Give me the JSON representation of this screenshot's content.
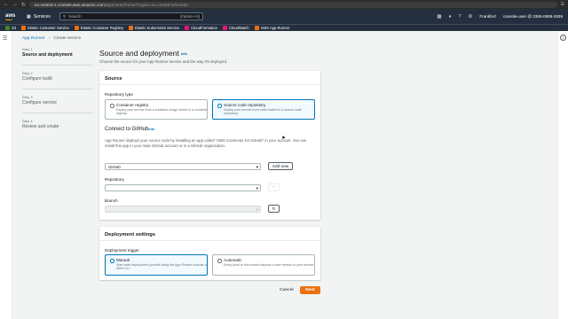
{
  "browser": {
    "url_host": "eu-central-1.console.aws.amazon.com",
    "url_path": "/apprunner/home?region=eu-central-1#/create"
  },
  "topnav": {
    "logo": "aws",
    "services_label": "Services",
    "search_placeholder": "Search",
    "search_shortcut": "[Option+S]",
    "region": "Frankfurt",
    "account": "console-user @ 3385-0698-2839"
  },
  "favorites": [
    {
      "label": "S3",
      "color": "#3f8624"
    },
    {
      "label": "Elastic Container Service",
      "color": "#ec7211"
    },
    {
      "label": "Elastic Container Registry",
      "color": "#ec7211"
    },
    {
      "label": "Elastic Kubernetes Service",
      "color": "#ec7211"
    },
    {
      "label": "CloudFormation",
      "color": "#e7157b"
    },
    {
      "label": "CloudWatch",
      "color": "#e7157b"
    },
    {
      "label": "AWS App Runner",
      "color": "#ec7211"
    }
  ],
  "breadcrumb": {
    "parent": "App Runner",
    "current": "Create service"
  },
  "steps": [
    {
      "num": "Step 1",
      "name": "Source and deployment"
    },
    {
      "num": "Step 2",
      "name": "Configure build"
    },
    {
      "num": "Step 3",
      "name": "Configure service"
    },
    {
      "num": "Step 4",
      "name": "Review and create"
    }
  ],
  "page": {
    "title": "Source and deployment",
    "info": "Info",
    "description": "Choose the source for your App Runner service and the way it's deployed."
  },
  "source": {
    "header": "Source",
    "repo_type_label": "Repository type",
    "option_registry_title": "Container registry",
    "option_registry_desc": "Deploy your service from a container image stored in a container registry.",
    "option_code_title": "Source code repository",
    "option_code_desc": "Deploy your service from code hosted in a source code repository.",
    "connect_title": "Connect to GitHub",
    "connect_info": "Info",
    "connect_desc": "App Runner deploys your source code by installing an app called \"AWS Connector for GitHub\" in your account. You can install this app in your main GitHub account or in a GitHub organization.",
    "connection_value": "GitHub",
    "add_new": "Add new",
    "repository_label": "Repository",
    "repository_value": "",
    "branch_label": "Branch",
    "branch_value": ""
  },
  "deployment": {
    "header": "Deployment settings",
    "trigger_label": "Deployment trigger",
    "manual_title": "Manual",
    "manual_desc": "Start each deployment yourself using the App Runner console or AWS CLI.",
    "auto_title": "Automatic",
    "auto_desc": "Every push to this branch deploys a new version of your service."
  },
  "actions": {
    "cancel": "Cancel",
    "next": "Next"
  }
}
